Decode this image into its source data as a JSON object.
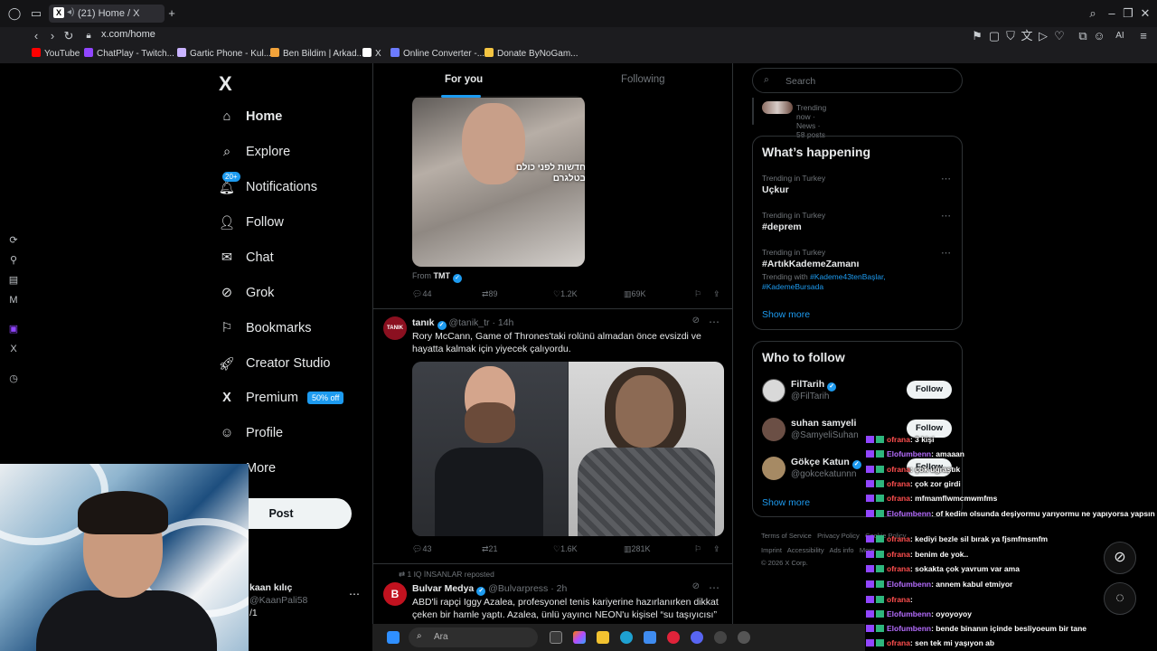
{
  "browser": {
    "tab_title": "(21) Home / X",
    "url": "x.com/home",
    "bookmarks": [
      "YouTube",
      "ChatPlay - Twitch...",
      "Gartic Phone - Kul...",
      "Ben Bildim | Arkad...",
      "X",
      "Online Converter -...",
      "Donate ByNoGam..."
    ],
    "ai_label": "AI"
  },
  "nav": {
    "logo": "X",
    "items": [
      {
        "label": "Home",
        "icon": "home-icon"
      },
      {
        "label": "Explore",
        "icon": "search-icon"
      },
      {
        "label": "Notifications",
        "icon": "bell-icon",
        "badge": "20+"
      },
      {
        "label": "Follow",
        "icon": "follow-icon"
      },
      {
        "label": "Chat",
        "icon": "mail-icon"
      },
      {
        "label": "Grok",
        "icon": "grok-icon"
      },
      {
        "label": "Bookmarks",
        "icon": "bookmark-icon"
      },
      {
        "label": "Creator Studio",
        "icon": "rocket-icon"
      },
      {
        "label": "Premium",
        "icon": "x-icon",
        "pill": "50% off"
      },
      {
        "label": "Profile",
        "icon": "person-icon"
      },
      {
        "label": "More",
        "icon": "more-icon"
      }
    ],
    "post_label": "Post",
    "account": {
      "name": "kaan kılıç",
      "handle": "@KaanPali58",
      "extra": "/1"
    }
  },
  "feed": {
    "tabs": [
      "For you",
      "Following"
    ],
    "tweet1": {
      "media_text": "חדשות לפני כולם בטלגרם",
      "from_label": "From",
      "from_name": "TMT",
      "replies": "44",
      "reposts": "89",
      "likes": "1.2K",
      "views": "69K"
    },
    "tweet2": {
      "avatar_text": "TANIK",
      "name": "tanık",
      "handle": "@tanik_tr · 14h",
      "text": "Rory McCann, Game of Thrones'taki rolünü almadan önce evsizdi ve hayatta kalmak için yiyecek çalıyordu.",
      "replies": "43",
      "reposts": "21",
      "likes": "1.6K",
      "views": "281K"
    },
    "tweet3": {
      "repost_label": "1 IQ İNSANLAR reposted",
      "name": "Bulvar Medya",
      "handle": "@Bulvarpress · 2h",
      "text": "ABD'li rapçi Iggy Azalea, profesyonel tenis kariyerine hazırlanırken dikkat çeken bir hamle yaptı. Azalea, ünlü yayıncı NEON'u kişisel “su taşıyıcısı”"
    }
  },
  "right": {
    "search_placeholder": "Search",
    "trending_now": "Trending now · News · 58 posts",
    "happening_title": "What’s happening",
    "trends": [
      {
        "context": "Trending in Turkey",
        "topic": "Uçkur"
      },
      {
        "context": "Trending in Turkey",
        "topic": "#deprem"
      },
      {
        "context": "Trending in Turkey",
        "topic": "#ArtıkKademeZamanı",
        "with_label": "Trending with",
        "with1": "#Kademe43tenBaşlar,",
        "with2": "#KademeBursada"
      }
    ],
    "show_more": "Show more",
    "wtf_title": "Who to follow",
    "follow_list": [
      {
        "name": "FilTarih",
        "handle": "@FilTarih",
        "verified": true
      },
      {
        "name": "suhan samyeli",
        "handle": "@SamyeliSuhan",
        "verified": false
      },
      {
        "name": "Gökçe Katun",
        "handle": "@gokcekatunnn",
        "verified": true
      }
    ],
    "follow_label": "Follow",
    "footer1": [
      "Terms of Service",
      "Privacy Policy",
      "Cookie Policy"
    ],
    "footer2": [
      "Imprint",
      "Accessibility",
      "Ads info",
      "More ..."
    ],
    "copyright": "© 2026 X Corp."
  },
  "chat": [
    {
      "user": "ofrana",
      "msg": ": 3 kişi",
      "c": "u1"
    },
    {
      "user": "Elofumbenn",
      "msg": ": amaaan",
      "c": "u2"
    },
    {
      "user": "ofrana",
      "msg": ": çok uğraştık",
      "c": "u1"
    },
    {
      "user": "ofrana",
      "msg": ": çok zor girdi",
      "c": "u1"
    },
    {
      "user": "ofrana",
      "msg": ": mfmamflwmcmwmfms",
      "c": "u1"
    },
    {
      "user": "Elofumbenn",
      "msg": ": of kedim olsunda deşiyormu yarıyormu ne yapıyorsa yapsın",
      "c": "u2"
    },
    {
      "user": "ofrana",
      "msg": ": kediyi bezle sil bırak ya fjsmfmsmfm",
      "c": "u1"
    },
    {
      "user": "ofrana",
      "msg": ": benim de yok..",
      "c": "u1"
    },
    {
      "user": "ofrana",
      "msg": ": sokakta çok yavrum var ama",
      "c": "u1"
    },
    {
      "user": "Elofumbenn",
      "msg": ": annem kabul etmiyor",
      "c": "u2"
    },
    {
      "user": "ofrana",
      "msg": ":",
      "c": "u1"
    },
    {
      "user": "Elofumbenn",
      "msg": ": oyoyoyoy",
      "c": "u2"
    },
    {
      "user": "Elofumbenn",
      "msg": ": bende binanın içinde besliyoeum bir tane",
      "c": "u2"
    },
    {
      "user": "ofrana",
      "msg": ": sen tek mi yaşıyon ab",
      "c": "u1"
    }
  ],
  "taskbar": {
    "search_label": "Ara"
  },
  "colors": {
    "accent": "#1d9bf0",
    "bg": "#000000",
    "muted": "#71767b"
  }
}
